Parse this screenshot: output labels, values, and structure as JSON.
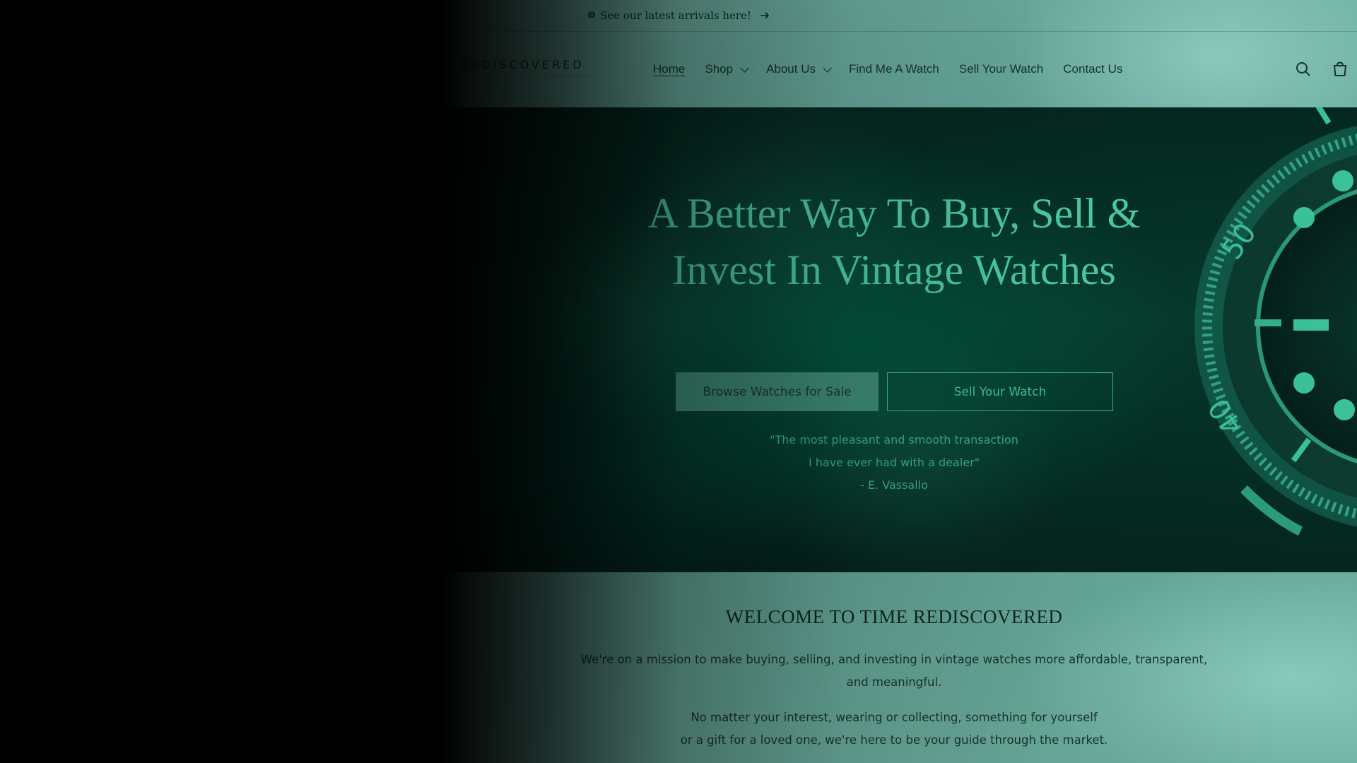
{
  "announcement": {
    "icon": "globe-icon",
    "text": "See our latest arrivals here!",
    "arrow_icon": "arrow-right-icon"
  },
  "header": {
    "logo_text": "REDISCOVERED",
    "nav": [
      {
        "label": "Home",
        "active": true
      },
      {
        "label": "Shop",
        "dropdown": true
      },
      {
        "label": "About Us",
        "dropdown": true
      },
      {
        "label": "Find Me A Watch"
      },
      {
        "label": "Sell Your Watch"
      },
      {
        "label": "Contact Us"
      }
    ],
    "icons": [
      "search-icon",
      "cart-icon"
    ]
  },
  "hero": {
    "title": "A Better Way To Buy, Sell & Invest In Vintage Watches",
    "primary_button": "Browse Watches for Sale",
    "secondary_button": "Sell Your Watch",
    "quote_line1": "\"The most pleasant and smooth transaction",
    "quote_line2": "I have ever had with a dealer\"",
    "quote_author": "- E. Vassallo",
    "bezel_numbers": [
      "50",
      "40"
    ]
  },
  "welcome": {
    "title": "WELCOME TO TIME REDISCOVERED",
    "paragraph1": "We're on a mission to make buying, selling, and investing in vintage watches more affordable, transparent, and meaningful.",
    "paragraph2_line1": "No matter your interest, wearing or collecting, something for yourself",
    "paragraph2_line2": "or a gift for a loved one, we're here to be your guide through the market."
  },
  "colors": {
    "accent_teal": "#45c79e",
    "hero_bg": "#063a2d",
    "primary_button_bg": "#3f8e7a",
    "overlay": "#000000"
  }
}
